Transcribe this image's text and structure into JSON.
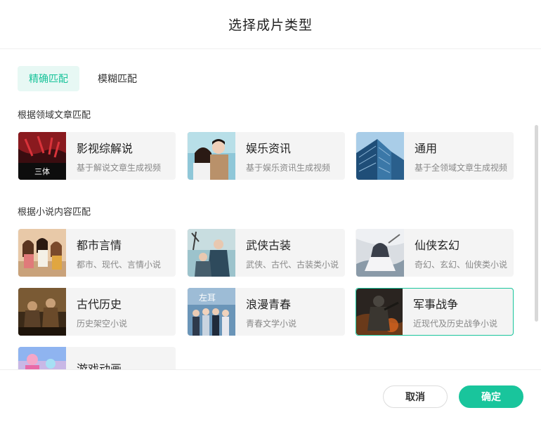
{
  "dialog": {
    "title": "选择成片类型"
  },
  "tabs": [
    {
      "label": "精确匹配",
      "active": true
    },
    {
      "label": "模糊匹配",
      "active": false
    }
  ],
  "sections": [
    {
      "label": "根据领域文章匹配"
    },
    {
      "label": "根据小说内容匹配"
    }
  ],
  "cards": [
    {
      "title": "影视综解说",
      "desc": "基于解说文章生成视频",
      "thumb_text": "三体"
    },
    {
      "title": "娱乐资讯",
      "desc": "基于娱乐资讯生成视频"
    },
    {
      "title": "通用",
      "desc": "基于全领域文章生成视频"
    },
    {
      "title": "都市言情",
      "desc": "都市、现代、言情小说"
    },
    {
      "title": "武侠古装",
      "desc": "武侠、古代、古装类小说"
    },
    {
      "title": "仙侠玄幻",
      "desc": "奇幻、玄幻、仙侠类小说"
    },
    {
      "title": "古代历史",
      "desc": "历史架空小说"
    },
    {
      "title": "浪漫青春",
      "desc": "青春文学小说",
      "thumb_text": "左耳"
    },
    {
      "title": "军事战争",
      "desc": "近现代及历史战争小说",
      "selected": true
    },
    {
      "title": "游戏动画",
      "desc": ""
    }
  ],
  "footer": {
    "cancel_label": "取消",
    "ok_label": "确定"
  },
  "colors": {
    "accent": "#19c59c",
    "tab_active_bg": "#e7f8f4",
    "card_bg": "#f4f4f4"
  }
}
